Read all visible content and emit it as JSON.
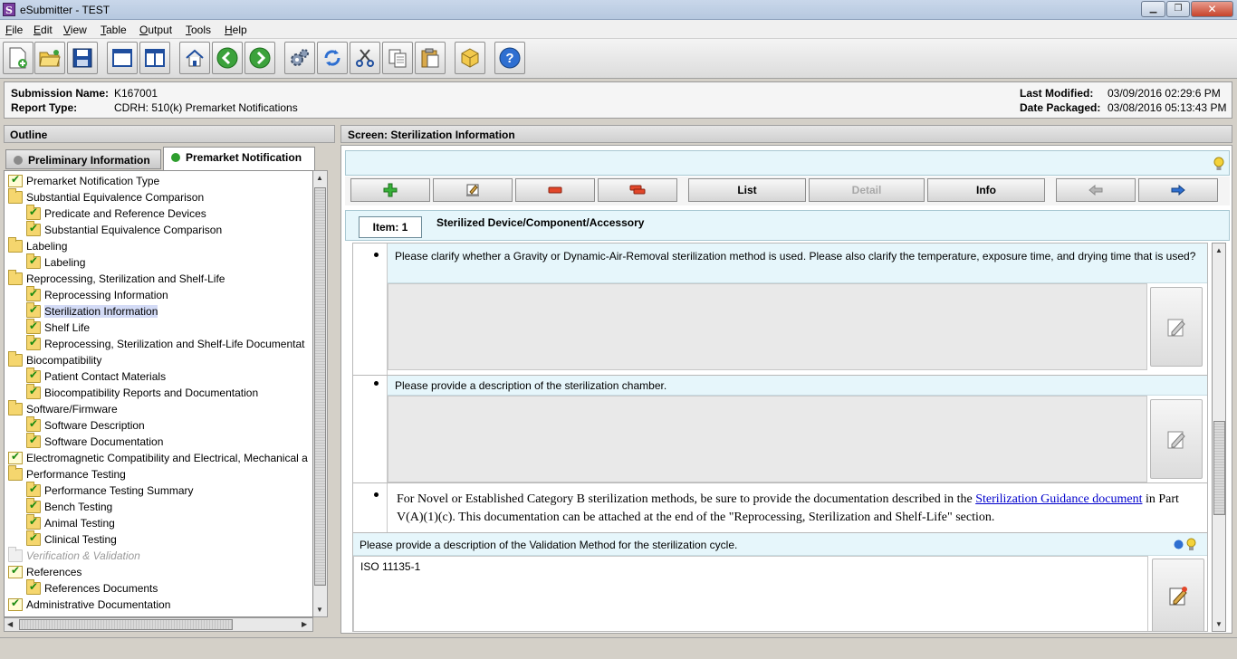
{
  "window": {
    "title": "eSubmitter - TEST",
    "icon_letter": "S"
  },
  "menu": [
    {
      "label": "File",
      "key": "F"
    },
    {
      "label": "Edit",
      "key": "E"
    },
    {
      "label": "View",
      "key": "V"
    },
    {
      "label": "Table",
      "key": "T"
    },
    {
      "label": "Output",
      "key": "O"
    },
    {
      "label": "Tools",
      "key": "T"
    },
    {
      "label": "Help",
      "key": "H"
    }
  ],
  "toolbar": {
    "icons": [
      "new-document-icon",
      "open-folder-icon",
      "save-icon",
      "window-icon",
      "split-view-icon",
      "home-icon",
      "back-icon",
      "forward-icon",
      "settings-icon",
      "refresh-icon",
      "cut-icon",
      "copy-icon",
      "paste-icon",
      "package-icon",
      "help-icon"
    ]
  },
  "info": {
    "submission_name_label": "Submission Name:",
    "submission_name": "K167001",
    "report_type_label": "Report Type:",
    "report_type": "CDRH: 510(k) Premarket Notifications",
    "last_modified_label": "Last Modified:",
    "last_modified": "03/09/2016 02:29:6 PM",
    "date_packaged_label": "Date Packaged:",
    "date_packaged": "03/08/2016 05:13:43 PM"
  },
  "outline": {
    "header": "Outline",
    "tabs": [
      {
        "label": "Preliminary Information",
        "status_color": "#8a8a8a"
      },
      {
        "label": "Premarket Notification",
        "status_color": "#2e9e2e"
      }
    ],
    "items": [
      {
        "label": "Premarket Notification Type",
        "level": 0,
        "icon": "doc-check-icon"
      },
      {
        "label": "Substantial Equivalence Comparison",
        "level": 0,
        "icon": "folder-icon"
      },
      {
        "label": "Predicate and Reference Devices",
        "level": 1,
        "icon": "folder-check-icon"
      },
      {
        "label": "Substantial Equivalence Comparison",
        "level": 1,
        "icon": "folder-check-icon"
      },
      {
        "label": "Labeling",
        "level": 0,
        "icon": "folder-icon"
      },
      {
        "label": "Labeling",
        "level": 1,
        "icon": "folder-check-icon"
      },
      {
        "label": "Reprocessing, Sterilization and Shelf-Life",
        "level": 0,
        "icon": "folder-icon"
      },
      {
        "label": "Reprocessing Information",
        "level": 1,
        "icon": "folder-check-icon"
      },
      {
        "label": "Sterilization Information",
        "level": 1,
        "icon": "folder-check-icon",
        "selected": true
      },
      {
        "label": "Shelf Life",
        "level": 1,
        "icon": "folder-check-icon"
      },
      {
        "label": "Reprocessing, Sterilization and Shelf-Life Documentat",
        "level": 1,
        "icon": "folder-check-icon"
      },
      {
        "label": "Biocompatibility",
        "level": 0,
        "icon": "folder-icon"
      },
      {
        "label": "Patient Contact Materials",
        "level": 1,
        "icon": "folder-check-icon"
      },
      {
        "label": "Biocompatibility Reports and Documentation",
        "level": 1,
        "icon": "folder-check-icon"
      },
      {
        "label": "Software/Firmware",
        "level": 0,
        "icon": "folder-icon"
      },
      {
        "label": "Software Description",
        "level": 1,
        "icon": "folder-check-icon"
      },
      {
        "label": "Software Documentation",
        "level": 1,
        "icon": "folder-check-icon"
      },
      {
        "label": "Electromagnetic Compatibility and Electrical, Mechanical a",
        "level": 0,
        "icon": "doc-check-icon"
      },
      {
        "label": "Performance Testing",
        "level": 0,
        "icon": "folder-icon"
      },
      {
        "label": "Performance Testing Summary",
        "level": 1,
        "icon": "folder-check-icon"
      },
      {
        "label": "Bench Testing",
        "level": 1,
        "icon": "folder-check-icon"
      },
      {
        "label": "Animal Testing",
        "level": 1,
        "icon": "folder-check-icon"
      },
      {
        "label": "Clinical Testing",
        "level": 1,
        "icon": "folder-check-icon"
      },
      {
        "label": "Verification & Validation",
        "level": 0,
        "icon": "folder-icon",
        "disabled": true
      },
      {
        "label": "References",
        "level": 0,
        "icon": "doc-check-icon"
      },
      {
        "label": "References Documents",
        "level": 1,
        "icon": "folder-check-icon"
      },
      {
        "label": "Administrative Documentation",
        "level": 0,
        "icon": "doc-check-icon"
      }
    ]
  },
  "screen": {
    "header": "Screen: Sterilization Information",
    "actions": [
      {
        "label": "",
        "icon": "add-icon"
      },
      {
        "label": "",
        "icon": "edit-record-icon"
      },
      {
        "label": "",
        "icon": "remove-icon"
      },
      {
        "label": "",
        "icon": "remove-all-icon"
      },
      {
        "label": "List"
      },
      {
        "label": "Detail",
        "disabled": true
      },
      {
        "label": "Info"
      },
      {
        "label": "",
        "icon": "prev-arrow-icon"
      },
      {
        "label": "",
        "icon": "next-arrow-icon"
      }
    ],
    "item_tab": "Item: 1",
    "item_title": "Sterilized Device/Component/Accessory",
    "questions": [
      {
        "text": "Please clarify whether a Gravity or Dynamic-Air-Removal sterilization method is used. Please also clarify the temperature, exposure time, and drying time that is used?",
        "answer": ""
      },
      {
        "text": "Please provide a description of the sterilization chamber.",
        "answer": ""
      }
    ],
    "guidance": {
      "before": "For Novel or Established Category B sterilization methods, be sure to provide the documentation described in the ",
      "link": "Sterilization Guidance document",
      "after": " in Part V(A)(1)(c). This documentation can be attached at the end of the \"Reprocessing, Sterilization and Shelf-Life\" section."
    },
    "validation": {
      "label": "Please provide a description of the Validation Method for the sterilization cycle.",
      "answer": "ISO 11135-1"
    }
  }
}
